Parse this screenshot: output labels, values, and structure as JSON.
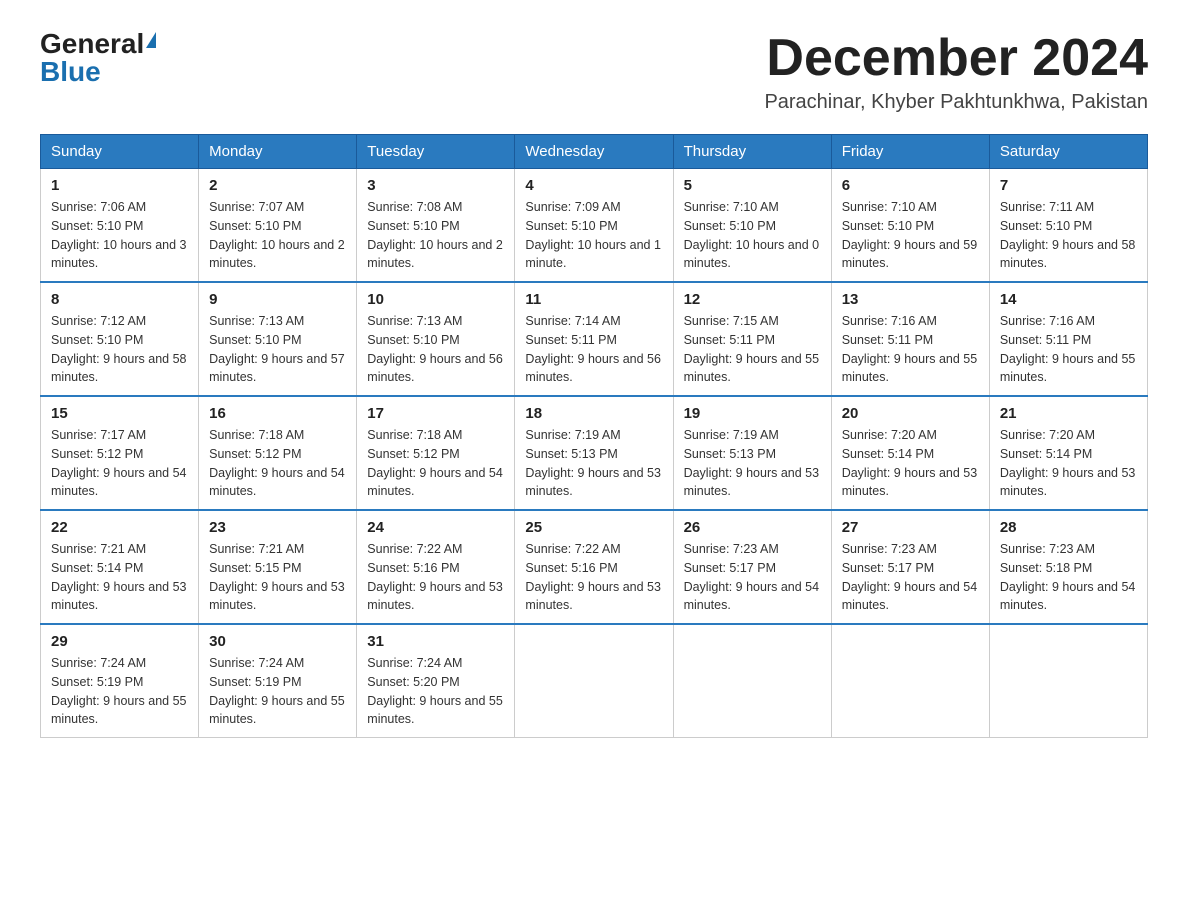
{
  "header": {
    "logo_general": "General",
    "logo_blue": "Blue",
    "month_title": "December 2024",
    "location": "Parachinar, Khyber Pakhtunkhwa, Pakistan"
  },
  "days_of_week": [
    "Sunday",
    "Monday",
    "Tuesday",
    "Wednesday",
    "Thursday",
    "Friday",
    "Saturday"
  ],
  "weeks": [
    [
      {
        "day": "1",
        "sunrise": "7:06 AM",
        "sunset": "5:10 PM",
        "daylight": "10 hours and 3 minutes."
      },
      {
        "day": "2",
        "sunrise": "7:07 AM",
        "sunset": "5:10 PM",
        "daylight": "10 hours and 2 minutes."
      },
      {
        "day": "3",
        "sunrise": "7:08 AM",
        "sunset": "5:10 PM",
        "daylight": "10 hours and 2 minutes."
      },
      {
        "day": "4",
        "sunrise": "7:09 AM",
        "sunset": "5:10 PM",
        "daylight": "10 hours and 1 minute."
      },
      {
        "day": "5",
        "sunrise": "7:10 AM",
        "sunset": "5:10 PM",
        "daylight": "10 hours and 0 minutes."
      },
      {
        "day": "6",
        "sunrise": "7:10 AM",
        "sunset": "5:10 PM",
        "daylight": "9 hours and 59 minutes."
      },
      {
        "day": "7",
        "sunrise": "7:11 AM",
        "sunset": "5:10 PM",
        "daylight": "9 hours and 58 minutes."
      }
    ],
    [
      {
        "day": "8",
        "sunrise": "7:12 AM",
        "sunset": "5:10 PM",
        "daylight": "9 hours and 58 minutes."
      },
      {
        "day": "9",
        "sunrise": "7:13 AM",
        "sunset": "5:10 PM",
        "daylight": "9 hours and 57 minutes."
      },
      {
        "day": "10",
        "sunrise": "7:13 AM",
        "sunset": "5:10 PM",
        "daylight": "9 hours and 56 minutes."
      },
      {
        "day": "11",
        "sunrise": "7:14 AM",
        "sunset": "5:11 PM",
        "daylight": "9 hours and 56 minutes."
      },
      {
        "day": "12",
        "sunrise": "7:15 AM",
        "sunset": "5:11 PM",
        "daylight": "9 hours and 55 minutes."
      },
      {
        "day": "13",
        "sunrise": "7:16 AM",
        "sunset": "5:11 PM",
        "daylight": "9 hours and 55 minutes."
      },
      {
        "day": "14",
        "sunrise": "7:16 AM",
        "sunset": "5:11 PM",
        "daylight": "9 hours and 55 minutes."
      }
    ],
    [
      {
        "day": "15",
        "sunrise": "7:17 AM",
        "sunset": "5:12 PM",
        "daylight": "9 hours and 54 minutes."
      },
      {
        "day": "16",
        "sunrise": "7:18 AM",
        "sunset": "5:12 PM",
        "daylight": "9 hours and 54 minutes."
      },
      {
        "day": "17",
        "sunrise": "7:18 AM",
        "sunset": "5:12 PM",
        "daylight": "9 hours and 54 minutes."
      },
      {
        "day": "18",
        "sunrise": "7:19 AM",
        "sunset": "5:13 PM",
        "daylight": "9 hours and 53 minutes."
      },
      {
        "day": "19",
        "sunrise": "7:19 AM",
        "sunset": "5:13 PM",
        "daylight": "9 hours and 53 minutes."
      },
      {
        "day": "20",
        "sunrise": "7:20 AM",
        "sunset": "5:14 PM",
        "daylight": "9 hours and 53 minutes."
      },
      {
        "day": "21",
        "sunrise": "7:20 AM",
        "sunset": "5:14 PM",
        "daylight": "9 hours and 53 minutes."
      }
    ],
    [
      {
        "day": "22",
        "sunrise": "7:21 AM",
        "sunset": "5:14 PM",
        "daylight": "9 hours and 53 minutes."
      },
      {
        "day": "23",
        "sunrise": "7:21 AM",
        "sunset": "5:15 PM",
        "daylight": "9 hours and 53 minutes."
      },
      {
        "day": "24",
        "sunrise": "7:22 AM",
        "sunset": "5:16 PM",
        "daylight": "9 hours and 53 minutes."
      },
      {
        "day": "25",
        "sunrise": "7:22 AM",
        "sunset": "5:16 PM",
        "daylight": "9 hours and 53 minutes."
      },
      {
        "day": "26",
        "sunrise": "7:23 AM",
        "sunset": "5:17 PM",
        "daylight": "9 hours and 54 minutes."
      },
      {
        "day": "27",
        "sunrise": "7:23 AM",
        "sunset": "5:17 PM",
        "daylight": "9 hours and 54 minutes."
      },
      {
        "day": "28",
        "sunrise": "7:23 AM",
        "sunset": "5:18 PM",
        "daylight": "9 hours and 54 minutes."
      }
    ],
    [
      {
        "day": "29",
        "sunrise": "7:24 AM",
        "sunset": "5:19 PM",
        "daylight": "9 hours and 55 minutes."
      },
      {
        "day": "30",
        "sunrise": "7:24 AM",
        "sunset": "5:19 PM",
        "daylight": "9 hours and 55 minutes."
      },
      {
        "day": "31",
        "sunrise": "7:24 AM",
        "sunset": "5:20 PM",
        "daylight": "9 hours and 55 minutes."
      },
      null,
      null,
      null,
      null
    ]
  ]
}
